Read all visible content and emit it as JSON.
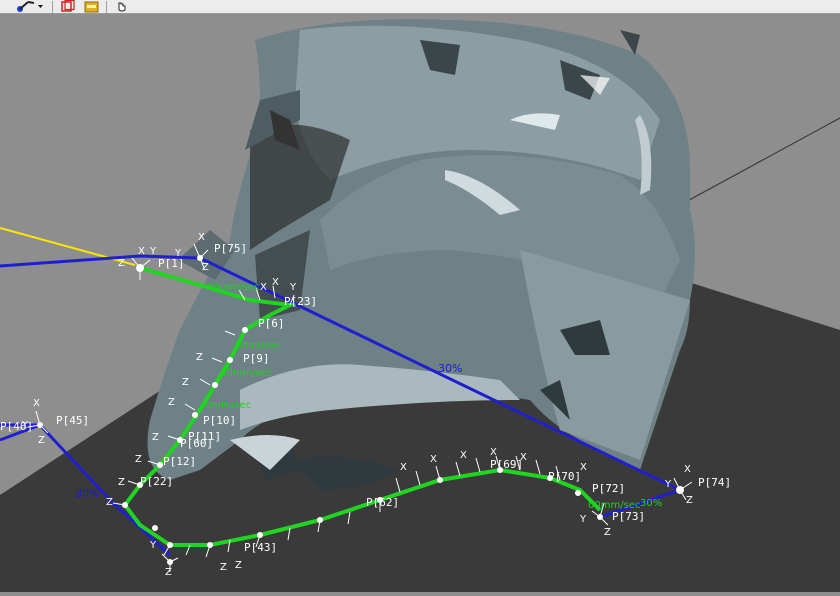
{
  "toolbar": {
    "tools": [
      {
        "name": "robot-pose-icon",
        "has_dropdown": true
      },
      {
        "name": "frame-view-icon",
        "has_dropdown": false
      },
      {
        "name": "folder-icon",
        "has_dropdown": false
      },
      {
        "name": "hand-pointer-icon",
        "has_dropdown": false
      }
    ]
  },
  "scene": {
    "background_color": "#8e8e8e",
    "floor_color": "#3a3a3a",
    "part_color": "#6f8288",
    "path_color": "#1f1fd0",
    "speed_path_color": "#22d422",
    "line_color": "#ffe600"
  },
  "labels": {
    "p1": "P[1]",
    "p75": "P[75]",
    "p23": "P[23]",
    "p6": "P[6]",
    "p9": "P[9]",
    "p10": "P[10]",
    "p11": "P[11]",
    "p60": "P[60]",
    "p45": "P[45]",
    "p46": "P[46]",
    "p69": "P[69]",
    "p70": "P[70]",
    "p72": "P[72]",
    "p73": "P[73]",
    "p74": "P[74]",
    "p43": "P[43]",
    "p62": "P[62]",
    "p12": "P[12]",
    "p22": "P[22]"
  },
  "speeds": {
    "s1": "00mm/sec",
    "s2": "0mm/sec",
    "s3": "00mm/sec",
    "s4": "0mm/sec",
    "s5": "00mm/sec"
  },
  "percent": {
    "upper": "30%",
    "lower": "30%",
    "right": "30%"
  }
}
